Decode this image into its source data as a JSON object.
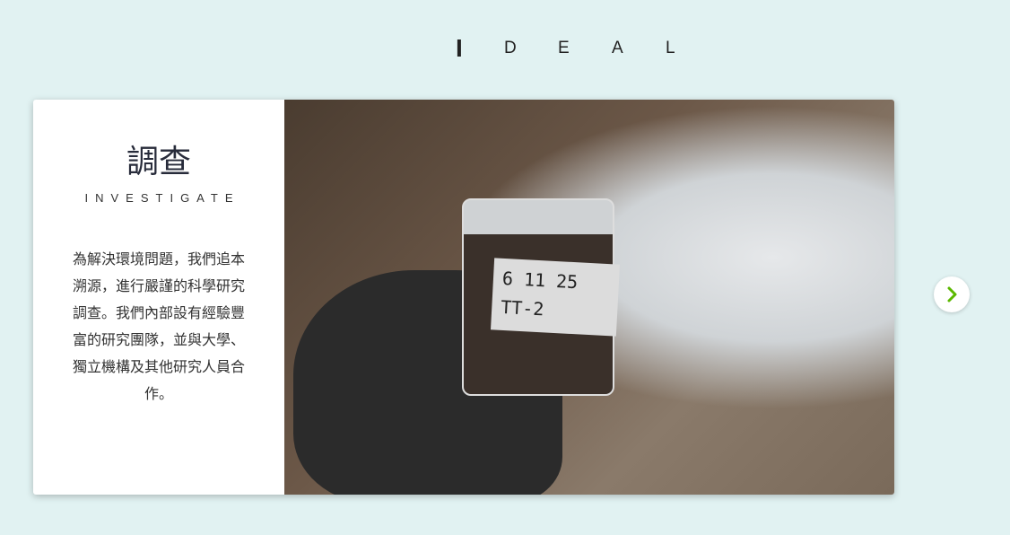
{
  "title_letters": [
    "I",
    "D",
    "E",
    "A",
    "L"
  ],
  "slide": {
    "heading": "調查",
    "subheading": "INVESTIGATE",
    "description": "為解決環境問題，我們追本溯源，進行嚴謹的科學研究調查。我們內部設有經驗豐富的研究團隊，並與大學、獨立機構及其他研究人員合作。",
    "photo_label_lines": [
      "6 11 25",
      "TT-2"
    ]
  },
  "next_icon": "chevron-right-icon",
  "accent_color": "#5bb800"
}
